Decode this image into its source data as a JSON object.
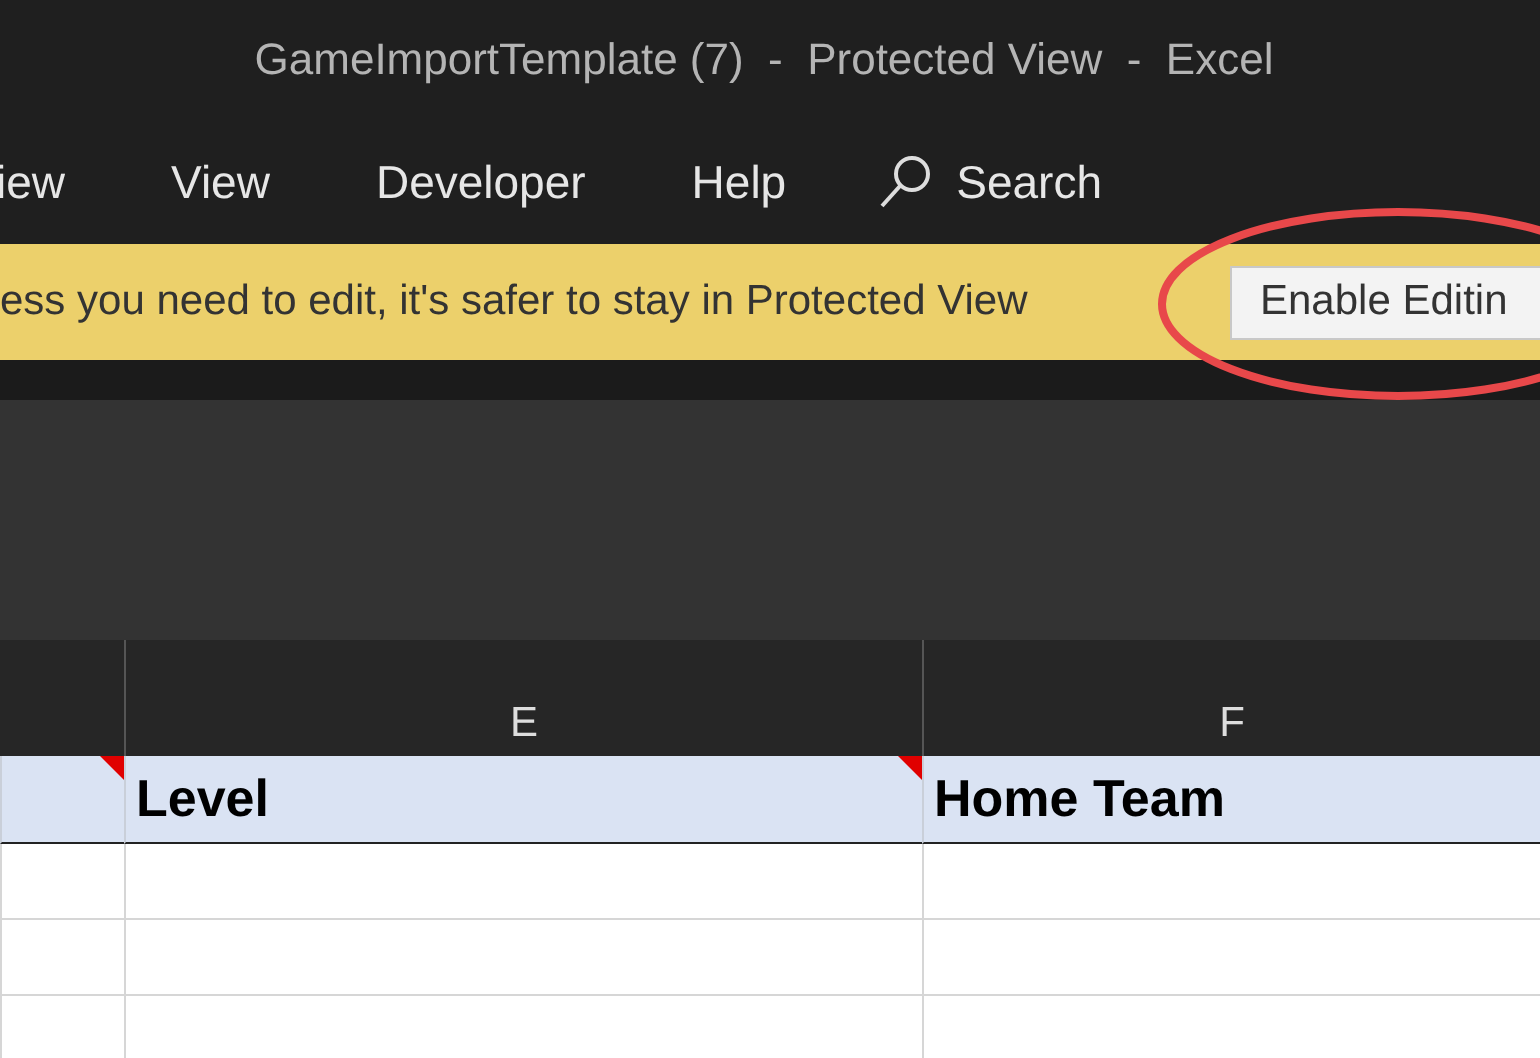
{
  "window": {
    "title": "GameImportTemplate (7)  -  Protected View  -  Excel"
  },
  "ribbon_tabs": [
    {
      "label": "iew"
    },
    {
      "label": "View"
    },
    {
      "label": "Developer"
    },
    {
      "label": "Help"
    }
  ],
  "search": {
    "label": "Search"
  },
  "message_bar": {
    "text": "ess you need to edit, it's safer to stay in Protected View",
    "button": "Enable Editin",
    "highlighted": true
  },
  "sheet": {
    "columns": [
      {},
      {
        "letter": "E"
      },
      {
        "letter": "F"
      }
    ],
    "header_row": [
      {
        "has_comment": true
      },
      {
        "text": "Level",
        "has_comment": true
      },
      {
        "text": "Home Team",
        "has_comment": false
      }
    ]
  }
}
